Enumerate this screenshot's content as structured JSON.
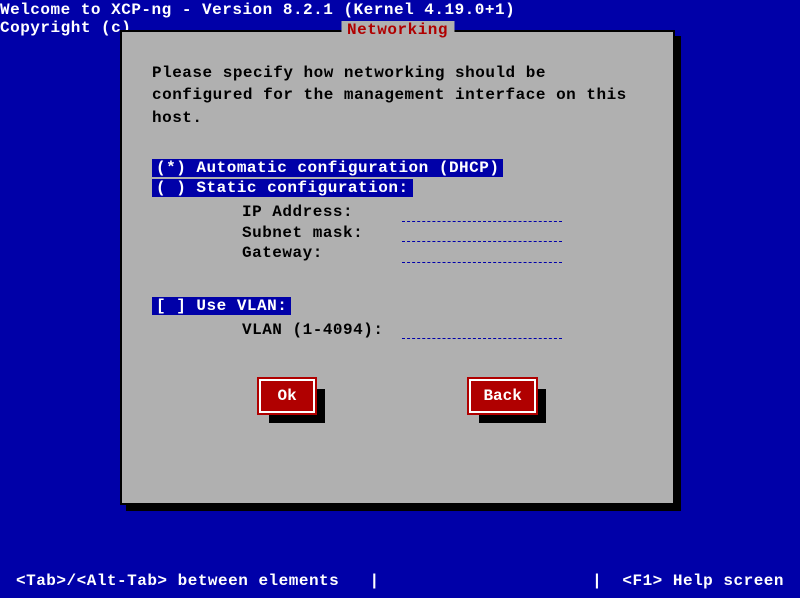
{
  "header": {
    "line1": "Welcome to XCP-ng - Version 8.2.1 (Kernel 4.19.0+1)",
    "line2": "Copyright (c)"
  },
  "dialog": {
    "title": "Networking",
    "prompt": "Please specify how networking should be configured for the management interface on this host.",
    "radios": {
      "dhcp": "(*) Automatic configuration (DHCP)",
      "static": "( ) Static configuration:"
    },
    "fields": {
      "ip_label": "IP Address:",
      "ip_value": "",
      "mask_label": "Subnet mask:",
      "mask_value": "",
      "gw_label": "Gateway:",
      "gw_value": "",
      "vlan_check": "[ ] Use VLAN:",
      "vlan_label": "VLAN (1-4094):",
      "vlan_value": ""
    },
    "buttons": {
      "ok": "Ok",
      "back": "Back"
    }
  },
  "footer": {
    "left": "<Tab>/<Alt-Tab> between elements   |",
    "right": "|  <F1> Help screen"
  }
}
